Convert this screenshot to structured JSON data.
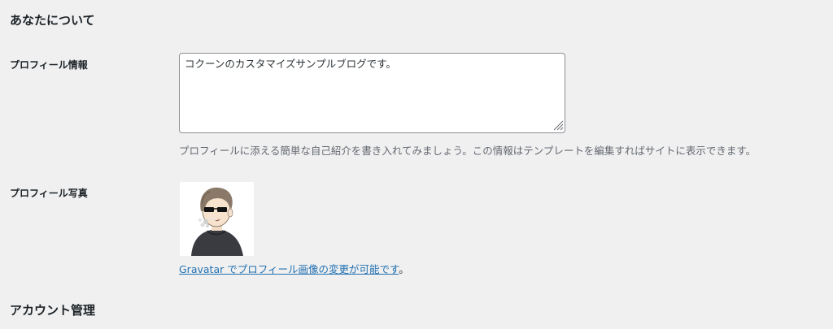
{
  "sections": {
    "about": {
      "heading": "あなたについて"
    },
    "account": {
      "heading": "アカウント管理"
    }
  },
  "bio": {
    "label": "プロフィール情報",
    "value": "コクーンのカスタマイズサンプルブログです。",
    "description": "プロフィールに添える簡単な自己紹介を書き入れてみましょう。この情報はテンプレートを編集すればサイトに表示できます。"
  },
  "photo": {
    "label": "プロフィール写真",
    "link_text": "Gravatar でプロフィール画像の変更が可能です",
    "link_suffix": "。"
  },
  "colors": {
    "background": "#f0f0f1",
    "link": "#2271b1",
    "description_text": "#646970",
    "input_border": "#8c8f94"
  }
}
